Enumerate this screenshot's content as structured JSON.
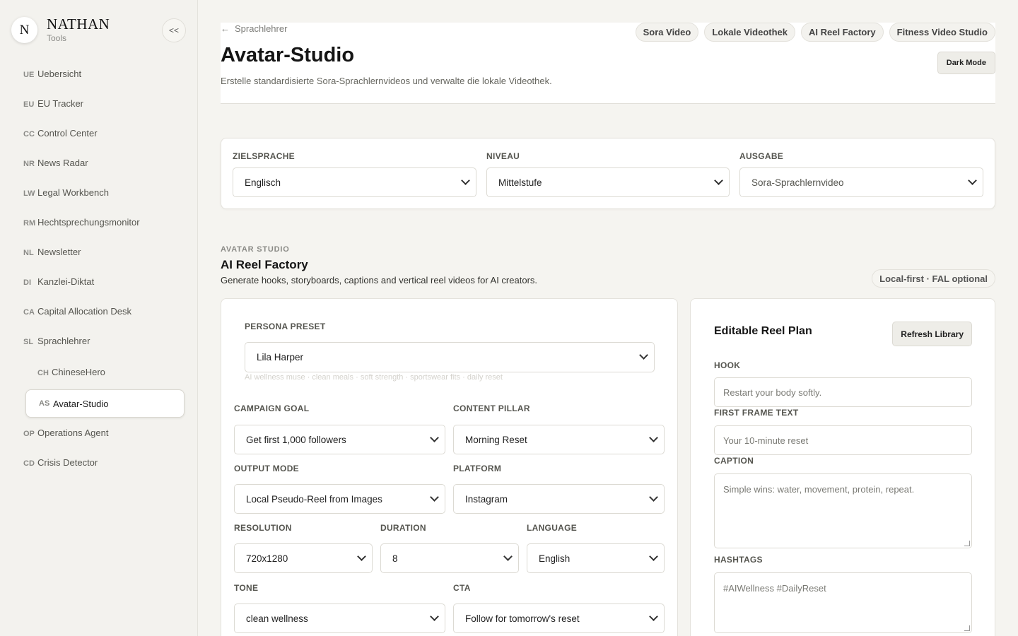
{
  "sidebar": {
    "avatar_letter": "N",
    "brand_name": "NATHAN",
    "brand_sub": "Tools",
    "collapse_label": "<<",
    "items": [
      {
        "code": "UE",
        "label": "Uebersicht"
      },
      {
        "code": "EU",
        "label": "EU Tracker"
      },
      {
        "code": "CC",
        "label": "Control Center"
      },
      {
        "code": "NR",
        "label": "News Radar"
      },
      {
        "code": "LW",
        "label": "Legal Workbench"
      },
      {
        "code": "RM",
        "label": "Hechtsprechungsmonitor"
      },
      {
        "code": "NL",
        "label": "Newsletter"
      },
      {
        "code": "DI",
        "label": "Kanzlei-Diktat"
      },
      {
        "code": "CA",
        "label": "Capital Allocation Desk"
      },
      {
        "code": "SL",
        "label": "Sprachlehrer"
      },
      {
        "code": "CH",
        "label": "ChineseHero"
      },
      {
        "code": "AS",
        "label": "Avatar-Studio"
      },
      {
        "code": "OP",
        "label": "Operations Agent"
      },
      {
        "code": "CD",
        "label": "Crisis Detector"
      }
    ]
  },
  "header": {
    "back_arrow": "←",
    "back_label": "Sprachlehrer",
    "title": "Avatar-Studio",
    "description": "Erstelle standardisierte Sora-Sprachlernvideos und verwalte die lokale Videothek.",
    "chips": [
      "Sora Video",
      "Lokale Videothek",
      "AI Reel Factory",
      "Fitness Video Studio"
    ],
    "dark_mode_label": "Dark Mode"
  },
  "settings": {
    "zielsprache_label": "ZIELSPRACHE",
    "zielsprache_value": "Englisch",
    "niveau_label": "NIVEAU",
    "niveau_value": "Mittelstufe",
    "ausgabe_label": "AUSGABE",
    "ausgabe_value": "Sora-Sprachlernvideo"
  },
  "section": {
    "kicker": "AVATAR STUDIO",
    "title": "AI Reel Factory",
    "description": "Generate hooks, storyboards, captions and vertical reel videos for AI creators.",
    "badge": "Local-first · FAL optional"
  },
  "form": {
    "persona_label": "PERSONA PRESET",
    "persona_value": "Lila Harper",
    "persona_hint": "AI wellness muse · clean meals · soft strength · sportswear fits · daily reset",
    "campaign_label": "CAMPAIGN GOAL",
    "campaign_value": "Get first 1,000 followers",
    "pillar_label": "CONTENT PILLAR",
    "pillar_value": "Morning Reset",
    "output_label": "OUTPUT MODE",
    "output_value": "Local Pseudo-Reel from Images",
    "platform_label": "PLATFORM",
    "platform_value": "Instagram",
    "resolution_label": "RESOLUTION",
    "resolution_value": "720x1280",
    "duration_label": "DURATION",
    "duration_value": "8",
    "language_label": "LANGUAGE",
    "language_value": "English",
    "tone_label": "TONE",
    "tone_value": "clean wellness",
    "cta_label": "CTA",
    "cta_value": "Follow for tomorrow's reset"
  },
  "plan": {
    "title": "Editable Reel Plan",
    "refresh_label": "Refresh Library",
    "hook_label": "HOOK",
    "hook_placeholder": "Restart your body softly.",
    "first_frame_label": "FIRST FRAME TEXT",
    "first_frame_placeholder": "Your 10-minute reset",
    "caption_label": "CAPTION",
    "caption_placeholder": "Simple wins: water, movement, protein, repeat.",
    "hashtags_label": "HASHTAGS",
    "hashtags_placeholder": "#AIWellness #DailyReset"
  }
}
